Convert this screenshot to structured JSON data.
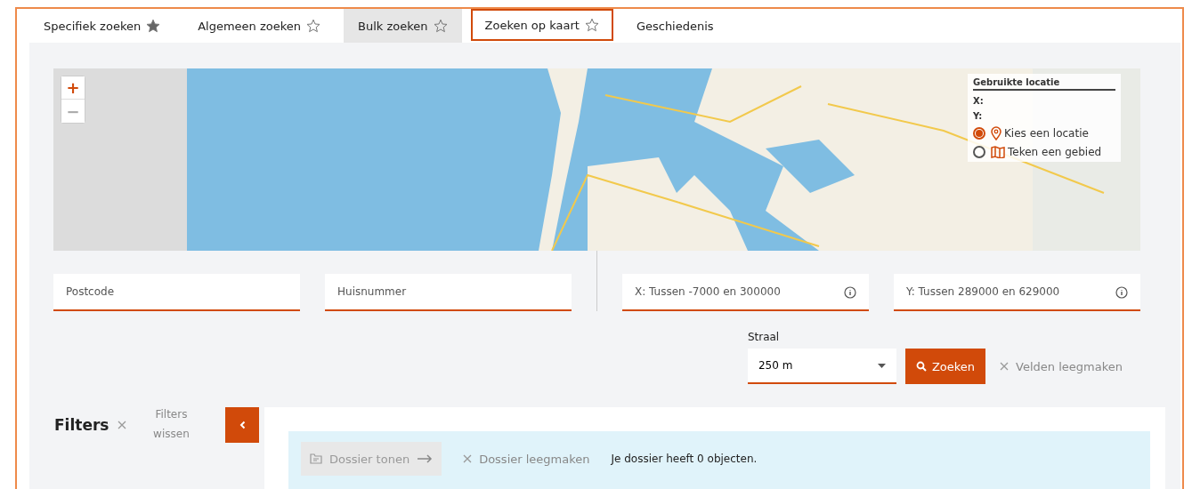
{
  "tabs": [
    {
      "label": "Specifiek zoeken",
      "starred": true,
      "hovered": false,
      "selected": false
    },
    {
      "label": "Algemeen zoeken",
      "starred": false,
      "hovered": false,
      "selected": false
    },
    {
      "label": "Bulk zoeken",
      "starred": false,
      "hovered": true,
      "selected": false
    },
    {
      "label": "Zoeken op kaart",
      "starred": false,
      "hovered": false,
      "selected": true
    },
    {
      "label": "Geschiedenis",
      "hovered": false,
      "selected": false
    }
  ],
  "map": {
    "zoom_in": "+",
    "zoom_out": "−",
    "location_panel": {
      "title": "Gebruikte locatie",
      "x_label": "X:",
      "y_label": "Y:",
      "options": [
        {
          "label": "Kies een locatie",
          "kind": "pin",
          "selected": true
        },
        {
          "label": "Teken een gebied",
          "kind": "area",
          "selected": false
        }
      ]
    }
  },
  "fields": [
    {
      "placeholder": "Postcode",
      "info": false
    },
    {
      "placeholder": "Huisnummer",
      "info": false
    },
    {
      "placeholder": "X: Tussen -7000 en 300000",
      "info": true
    },
    {
      "placeholder": "Y: Tussen 289000 en 629000",
      "info": true
    }
  ],
  "radius": {
    "label": "Straal",
    "value": "250 m"
  },
  "search_button": "Zoeken",
  "clear_fields": "Velden leegmaken",
  "filters": {
    "title": "Filters",
    "clear": "Filters wissen"
  },
  "dossier": {
    "show": "Dossier tonen",
    "show_disabled": true,
    "clear": "Dossier leegmaken",
    "message": "Je dossier heeft 0 objecten."
  }
}
